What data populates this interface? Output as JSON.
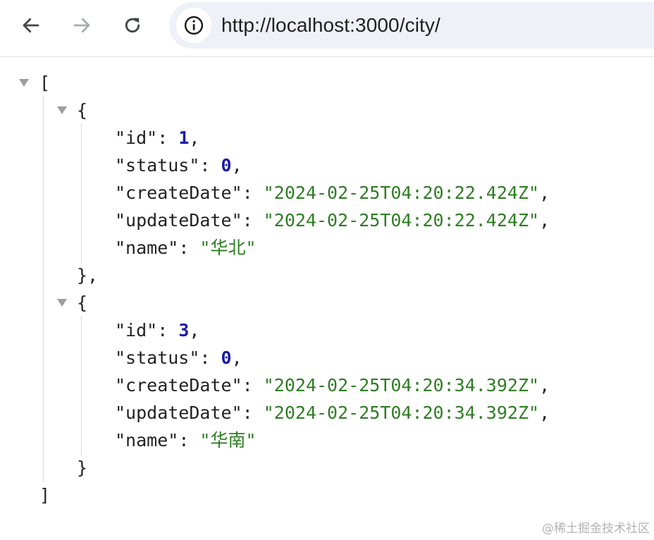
{
  "browser": {
    "url": "http://localhost:3000/city/",
    "back_icon": "arrow-left-icon",
    "forward_icon": "arrow-right-icon",
    "reload_icon": "reload-icon",
    "site_info_icon": "info-circle-icon"
  },
  "json": {
    "open_bracket": "[",
    "close_bracket": "]",
    "open_brace": "{",
    "close_brace": "}",
    "close_brace_comma": "},",
    "records": [
      {
        "fields": [
          {
            "key": "\"id\"",
            "value": "1",
            "type": "number",
            "comma": ","
          },
          {
            "key": "\"status\"",
            "value": "0",
            "type": "number",
            "comma": ","
          },
          {
            "key": "\"createDate\"",
            "value": "\"2024-02-25T04:20:22.424Z\"",
            "type": "string",
            "comma": ","
          },
          {
            "key": "\"updateDate\"",
            "value": "\"2024-02-25T04:20:22.424Z\"",
            "type": "string",
            "comma": ","
          },
          {
            "key": "\"name\"",
            "value": "\"华北\"",
            "type": "string",
            "comma": ""
          }
        ]
      },
      {
        "fields": [
          {
            "key": "\"id\"",
            "value": "3",
            "type": "number",
            "comma": ","
          },
          {
            "key": "\"status\"",
            "value": "0",
            "type": "number",
            "comma": ","
          },
          {
            "key": "\"createDate\"",
            "value": "\"2024-02-25T04:20:34.392Z\"",
            "type": "string",
            "comma": ","
          },
          {
            "key": "\"updateDate\"",
            "value": "\"2024-02-25T04:20:34.392Z\"",
            "type": "string",
            "comma": ","
          },
          {
            "key": "\"name\"",
            "value": "\"华南\"",
            "type": "string",
            "comma": ""
          }
        ]
      }
    ]
  },
  "watermark": "@稀土掘金技术社区",
  "colors": {
    "number": "#1a1aa6",
    "string": "#2e7d23",
    "punctuation": "#222222"
  }
}
